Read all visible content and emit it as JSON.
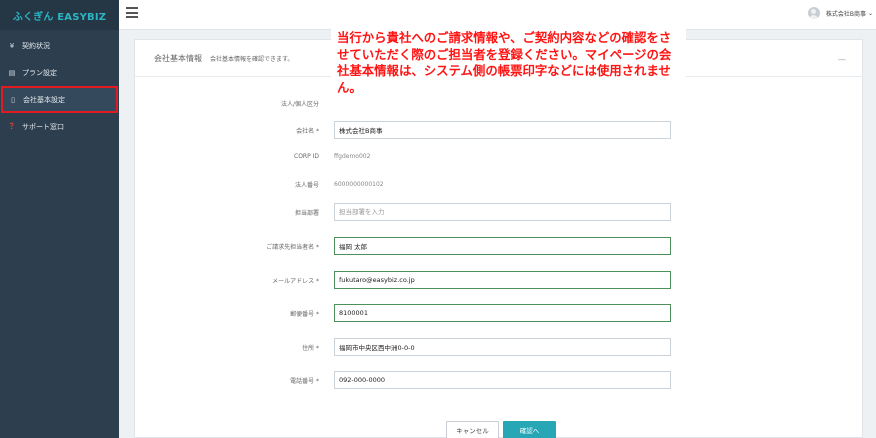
{
  "sidebar": {
    "brand": "ふくぎん EASYBIZ",
    "items": [
      {
        "icon": "¥",
        "label": "契約状況"
      },
      {
        "icon": "▤",
        "label": "プラン設定"
      },
      {
        "icon": "▯",
        "label": "会社基本設定"
      },
      {
        "icon": "❓",
        "label": "サポート窓口"
      }
    ]
  },
  "header": {
    "user_name": "株式会社B商事",
    "caret": "⌄"
  },
  "panel": {
    "title": "会社基本情報",
    "subtitle": "会社基本情報を確認できます。",
    "minimize": "—"
  },
  "form": {
    "entity_type_label": "法人/個人区分",
    "company_name_label": "会社名 *",
    "company_name_value": "株式会社B商事",
    "corp_id_label": "CORP ID",
    "corp_id_value": "ffgdemo002",
    "corp_number_label": "法人番号",
    "corp_number_value": "6000000000102",
    "dept_label": "担当部署",
    "dept_placeholder": "担当部署を入力",
    "contact_label": "ご請求先担当者名 *",
    "contact_value": "福岡 太郎",
    "email_label": "メールアドレス *",
    "email_value": "fukutaro@easybiz.co.jp",
    "postal_label": "郵便番号 *",
    "postal_value": "8100001",
    "address_label": "住所 *",
    "address_value": "福岡市中央区西中洲0-0-0",
    "phone_label": "電話番号 *",
    "phone_value": "092-000-0000"
  },
  "buttons": {
    "cancel": "キャンセル",
    "confirm": "確認へ"
  },
  "annotation": {
    "text": "当行から貴社へのご請求情報や、ご契約内容などの確認をさせていただく際のご担当者を登録ください。マイページの会社基本情報は、システム側の帳票印字などには使用されません。"
  },
  "colors": {
    "sidebar_bg": "#2d3e4f",
    "brand_text": "#2bb5c3",
    "active_border": "#e21b23",
    "confirm_button": "#27a6b5",
    "valid_border": "#4f8f5b",
    "annotation_text": "#ff1414"
  }
}
